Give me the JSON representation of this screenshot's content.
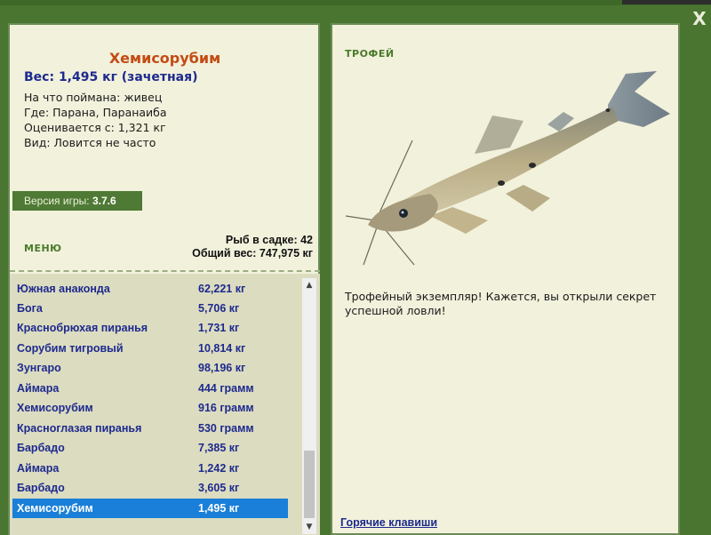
{
  "window": {
    "close_label": "X"
  },
  "fish": {
    "title": "Хемисорубим",
    "weight": "Вес: 1,495 кг (зачетная)",
    "info": [
      "На что поймана: живец",
      "Где: Парана, Паранаиба",
      "Оценивается с: 1,321 кг",
      "Вид: Ловится не часто"
    ]
  },
  "version": {
    "label": "Версия игры:",
    "value": "3.7.6"
  },
  "menu": {
    "label": "МЕНЮ"
  },
  "stats": {
    "fish_count": "Рыб в садке: 42",
    "total_weight": "Общий вес: 747,975 кг"
  },
  "catch_list": [
    {
      "name": "Южная анаконда",
      "weight": "62,221 кг"
    },
    {
      "name": "Бога",
      "weight": "5,706 кг"
    },
    {
      "name": "Краснобрюхая пиранья",
      "weight": "1,731 кг"
    },
    {
      "name": "Сорубим тигровый",
      "weight": "10,814 кг"
    },
    {
      "name": "Зунгаро",
      "weight": "98,196 кг"
    },
    {
      "name": "Аймара",
      "weight": "444 грамм"
    },
    {
      "name": "Хемисорубим",
      "weight": "916 грамм"
    },
    {
      "name": "Красноглазая пиранья",
      "weight": "530 грамм"
    },
    {
      "name": "Барбадо",
      "weight": "7,385 кг"
    },
    {
      "name": "Аймара",
      "weight": "1,242 кг"
    },
    {
      "name": "Барбадо",
      "weight": "3,605 кг"
    },
    {
      "name": "Хемисорубим",
      "weight": "1,495 кг",
      "selected": true
    }
  ],
  "trophy": {
    "label": "ТРОФЕЙ",
    "text": "Трофейный экземпляр! Кажется, вы открыли секрет успешной ловли!"
  },
  "hotkeys": {
    "label": "Горячие клавиши"
  },
  "colors": {
    "accent_blue": "#1d2a8e",
    "title_orange": "#c44b14",
    "selection": "#1a7fd8",
    "frame_green": "#4a7531"
  }
}
